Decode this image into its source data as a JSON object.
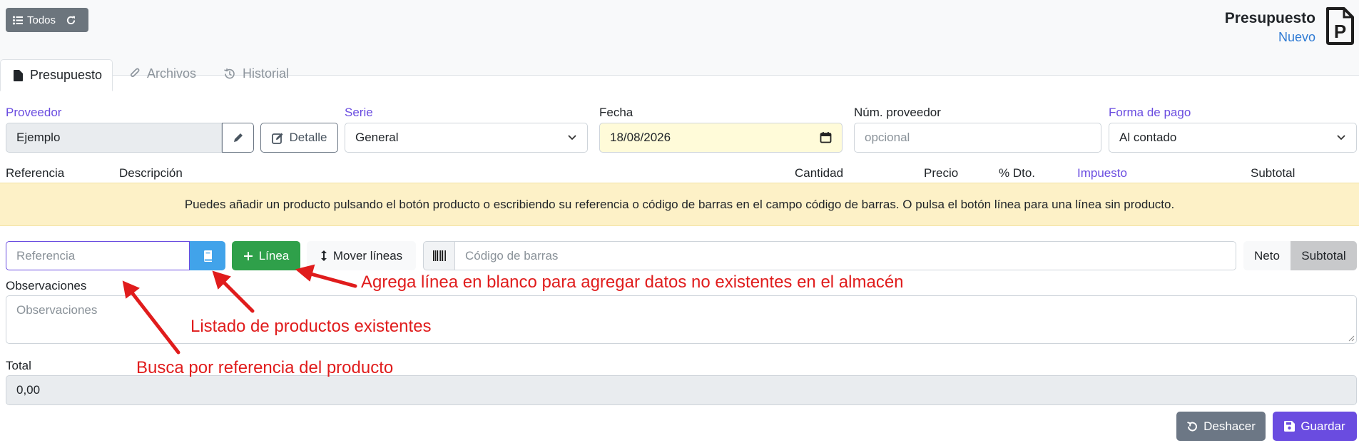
{
  "header": {
    "todos_label": "Todos",
    "doc_title": "Presupuesto",
    "doc_status": "Nuevo",
    "doc_icon_letter": "P"
  },
  "tabs": [
    {
      "label": "Presupuesto",
      "icon": "file-icon",
      "active": true
    },
    {
      "label": "Archivos",
      "icon": "paperclip-icon",
      "active": false
    },
    {
      "label": "Historial",
      "icon": "history-icon",
      "active": false
    }
  ],
  "form": {
    "proveedor_label": "Proveedor",
    "proveedor_value": "Ejemplo",
    "detalle_label": "Detalle",
    "serie_label": "Serie",
    "serie_value": "General",
    "fecha_label": "Fecha",
    "fecha_value": "18/08/2026",
    "numproveedor_label": "Núm. proveedor",
    "numproveedor_placeholder": "opcional",
    "formapago_label": "Forma de pago",
    "formapago_value": "Al contado"
  },
  "lines_table": {
    "columns": [
      "Referencia",
      "Descripción",
      "Cantidad",
      "Precio",
      "% Dto.",
      "Impuesto",
      "Subtotal"
    ],
    "empty_message": "Puedes añadir un producto pulsando el botón producto o escribiendo su referencia o código de barras en el campo código de barras. O pulsa el botón línea para una línea sin producto."
  },
  "toolbar": {
    "referencia_placeholder": "Referencia",
    "linea_label": "Línea",
    "mover_label": "Mover líneas",
    "barcode_placeholder": "Código de barras",
    "neto_label": "Neto",
    "subtotal_label": "Subtotal"
  },
  "observaciones": {
    "label": "Observaciones",
    "placeholder": "Observaciones"
  },
  "total": {
    "label": "Total",
    "value": "0,00"
  },
  "actions": {
    "deshacer_label": "Deshacer",
    "guardar_label": "Guardar"
  },
  "annotations": {
    "linea_note": "Agrega línea en blanco para agregar datos no existentes en el almacén",
    "productos_note": "Listado de productos existentes",
    "referencia_note": "Busca por referencia del producto"
  },
  "colors": {
    "primary": "#6a4ce0",
    "success": "#2fa04a",
    "info": "#41a3ea",
    "secondary": "#6c757d",
    "annotation": "#e01c1c",
    "alert_bg": "#fdf1c7"
  }
}
